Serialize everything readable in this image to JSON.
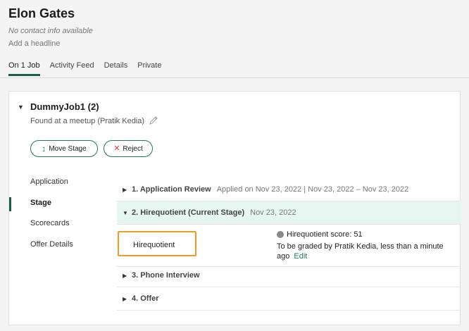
{
  "candidate": {
    "name": "Elon Gates",
    "contact": "No contact info available",
    "headline": "Add a headline"
  },
  "tabs": [
    {
      "label": "On 1 Job",
      "active": true
    },
    {
      "label": "Activity Feed",
      "active": false
    },
    {
      "label": "Details",
      "active": false
    },
    {
      "label": "Private",
      "active": false
    }
  ],
  "job": {
    "caret": "▼",
    "title": "DummyJob1 (2)",
    "source": "Found at a meetup (Pratik Kedia)",
    "move_stage_label": "Move Stage",
    "reject_label": "Reject"
  },
  "sidebar": {
    "items": [
      {
        "label": "Application"
      },
      {
        "label": "Stage"
      },
      {
        "label": "Scorecards"
      },
      {
        "label": "Offer Details"
      }
    ]
  },
  "stages": [
    {
      "caret": "▶",
      "title": "1. Application Review",
      "meta": "Applied on Nov 23, 2022 | Nov 23, 2022 – Nov 23, 2022"
    },
    {
      "caret": "▼",
      "title": "2. Hirequotient (Current Stage)",
      "meta": "Nov 23, 2022"
    },
    {
      "caret": "▶",
      "title": "3. Phone Interview",
      "meta": ""
    },
    {
      "caret": "▶",
      "title": "4. Offer",
      "meta": ""
    }
  ],
  "stage_detail": {
    "interview_name": "Hirequotient",
    "score": "Hirequotient score: 51",
    "graded": "To be graded by Pratik Kedia, less than a minute ago",
    "edit_label": "Edit"
  },
  "colors": {
    "accent": "#1e5b44",
    "button_border": "#1e7a58",
    "reject": "#d23b3b",
    "highlight": "#f29b28",
    "current_stage_bg": "#e6f7f2"
  }
}
